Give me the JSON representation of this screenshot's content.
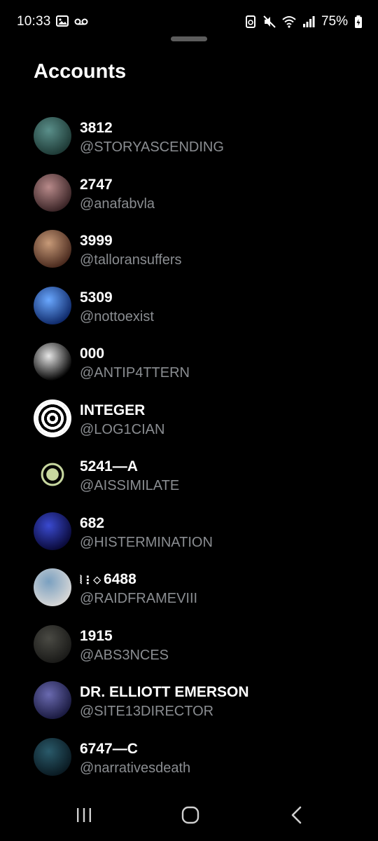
{
  "status_bar": {
    "time": "10:33",
    "battery": "75%"
  },
  "sheet": {
    "title": "Accounts"
  },
  "accounts": [
    {
      "name": "3812",
      "handle": "@STORYASCENDING",
      "avatar_colors": [
        "#1e3a36",
        "#5a8f8a"
      ]
    },
    {
      "name": "2747",
      "handle": "@anafabvla",
      "avatar_colors": [
        "#3a2426",
        "#b88a8a"
      ]
    },
    {
      "name": "3999",
      "handle": "@talloransuffers",
      "avatar_colors": [
        "#4a2a1e",
        "#c79a78"
      ]
    },
    {
      "name": "5309",
      "handle": "@nottoexist",
      "avatar_colors": [
        "#0f2a6a",
        "#6aa8ff"
      ]
    },
    {
      "name": "000",
      "handle": "@ANTIP4TTERN",
      "avatar_colors": [
        "#000000",
        "#e6e6e6"
      ]
    },
    {
      "name": "INTEGER",
      "handle": "@LOG1CIAN",
      "avatar_colors": [
        "#ffffff",
        "#000000"
      ]
    },
    {
      "name": "5241—A",
      "handle": "@AISSIMILATE",
      "avatar_colors": [
        "#000000",
        "#c8d8a0"
      ]
    },
    {
      "name": "682",
      "handle": "@HISTERMINATION",
      "avatar_colors": [
        "#0a0a3a",
        "#3a4ad0"
      ]
    },
    {
      "name": "6488",
      "name_prefix": "⦚⋮⬦",
      "handle": "@RAIDFRAMEVIII",
      "avatar_colors": [
        "#d6d6d6",
        "#7aa0c0"
      ]
    },
    {
      "name": "1915",
      "handle": "@ABS3NCES",
      "avatar_colors": [
        "#1a1a18",
        "#4a4a44"
      ]
    },
    {
      "name": "DR. ELLIOTT EMERSON",
      "handle": "@SITE13DIRECTOR",
      "avatar_colors": [
        "#1a1a40",
        "#6a6ab0"
      ]
    },
    {
      "name": "6747—C",
      "handle": "@narrativesdeath",
      "avatar_colors": [
        "#0a1a22",
        "#2a5a6a"
      ]
    }
  ],
  "nav": {
    "icons": [
      "recent-apps-icon",
      "home-icon",
      "back-icon"
    ]
  }
}
